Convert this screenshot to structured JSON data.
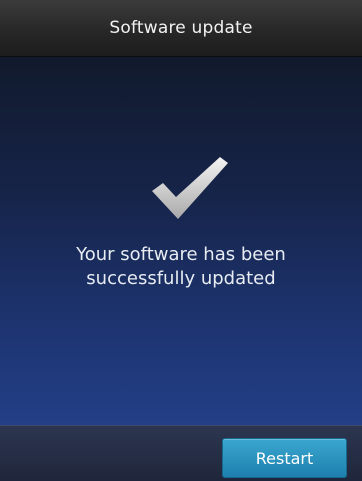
{
  "header": {
    "title": "Software update"
  },
  "main": {
    "icon": "checkmark-icon",
    "message_line1": "Your software has been",
    "message_line2": "successfully updated"
  },
  "footer": {
    "restart_label": "Restart"
  },
  "colors": {
    "accent": "#2a93c2",
    "background_top": "#111a2c",
    "background_bottom": "#233f86"
  }
}
